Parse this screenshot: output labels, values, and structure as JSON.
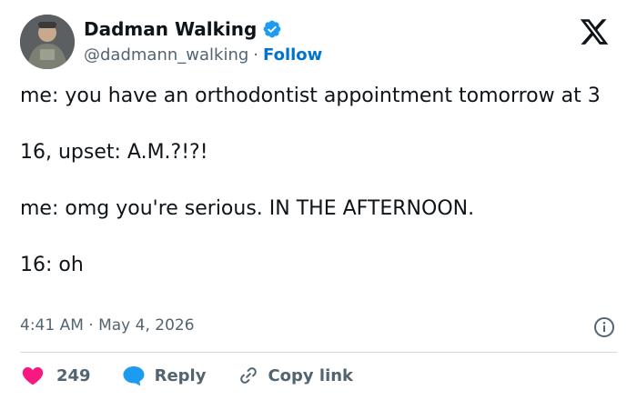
{
  "author": {
    "display_name": "Dadman Walking",
    "handle": "@dadmann_walking",
    "separator": "·",
    "follow_label": "Follow"
  },
  "tweet": {
    "lines": [
      "me: you have an orthodontist appointment tomorrow at 3",
      "16, upset: A.M.?!?!",
      "me: omg you're serious. IN THE AFTERNOON.",
      "16: oh"
    ],
    "timestamp": "4:41 AM · May 4, 2026"
  },
  "actions": {
    "like_count": "249",
    "reply_label": "Reply",
    "copy_label": "Copy link"
  },
  "colors": {
    "accent": "#1d9bf0",
    "follow": "#0074cc",
    "like": "#f91880",
    "muted": "#536471",
    "text": "#0f1419"
  },
  "icons": [
    "verified-badge-icon",
    "x-logo-icon",
    "info-icon",
    "heart-icon",
    "reply-bubble-icon",
    "link-icon"
  ]
}
